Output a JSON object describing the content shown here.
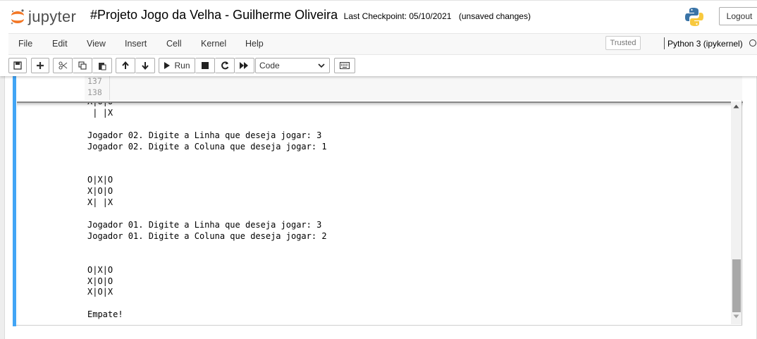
{
  "header": {
    "logo_text": "jupyter",
    "notebook_title": "#Projeto Jogo da Velha - Guilherme Oliveira",
    "checkpoint": "Last Checkpoint: 05/10/2021",
    "autosave_status": "(unsaved changes)",
    "logout_label": "Logout"
  },
  "menubar": {
    "items": [
      "File",
      "Edit",
      "View",
      "Insert",
      "Cell",
      "Kernel",
      "Help"
    ],
    "trusted_label": "Trusted",
    "kernel_name": "Python 3 (ipykernel)"
  },
  "toolbar": {
    "run_label": "Run",
    "cell_type": "Code",
    "icons": [
      "save-icon",
      "plus-icon",
      "cut-icon",
      "copy-icon",
      "paste-icon",
      "arrow-up-icon",
      "arrow-down-icon",
      "run-icon",
      "stop-icon",
      "restart-icon",
      "fast-forward-icon",
      "keyboard-icon"
    ]
  },
  "cell": {
    "line_numbers": [
      "137",
      "138"
    ],
    "output_text": "X|O|O\n | |X\n\nJogador 02. Digite a Linha que deseja jogar: 3\nJogador 02. Digite a Coluna que deseja jogar: 1\n\n\nO|X|O\nX|O|O\nX| |X\n\nJogador 01. Digite a Linha que deseja jogar: 3\nJogador 01. Digite a Coluna que deseja jogar: 2\n\n\nO|X|O\nX|O|O\nX|O|X\n\nEmpate!"
  },
  "colors": {
    "selected_cell_bar": "#42a5f5",
    "jupyter_orange": "#f37726"
  }
}
